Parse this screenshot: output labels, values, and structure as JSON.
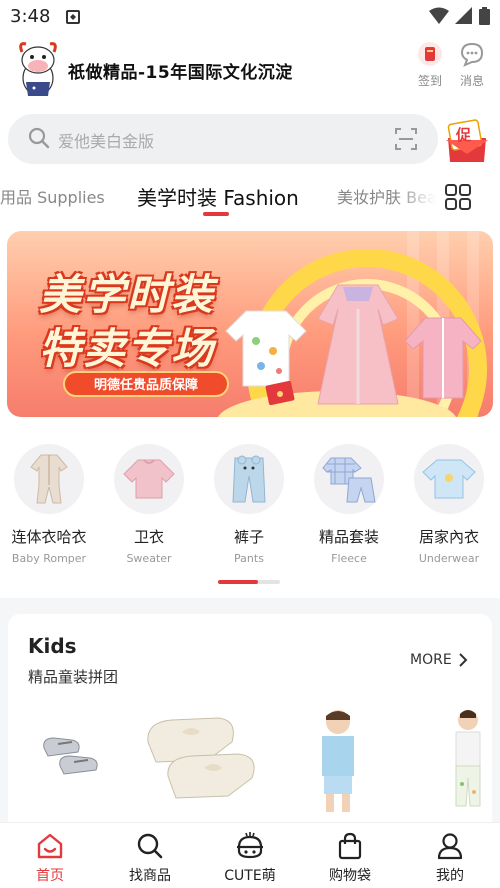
{
  "status_bar": {
    "time": "3:48"
  },
  "header": {
    "shop_title": "祇做精品-15年国际文化沉淀",
    "checkin_label": "签到",
    "message_label": "消息"
  },
  "search": {
    "placeholder": "爱他美白金版",
    "icon": "search-icon",
    "scan_icon": "scan-icon",
    "promo_badge": "促"
  },
  "tabs": {
    "items": [
      {
        "label": "用品 Supplies"
      },
      {
        "label": "美学时装 Fashion",
        "active": true
      },
      {
        "label": "美妆护肤 Bea"
      }
    ],
    "grid_icon": "grid-icon"
  },
  "banner": {
    "line1": "美学时装",
    "line2": "特卖专场",
    "tagline": "明德任贵品质保障"
  },
  "categories": [
    {
      "cn": "连体衣哈衣",
      "en": "Baby Romper"
    },
    {
      "cn": "卫衣",
      "en": "Sweater"
    },
    {
      "cn": "裤子",
      "en": "Pants"
    },
    {
      "cn": "精品套装",
      "en": "Fleece"
    },
    {
      "cn": "居家內衣",
      "en": "Underwear"
    }
  ],
  "kids": {
    "title": "Kids",
    "subtitle": "精品童装拼团",
    "more": "MORE"
  },
  "bottom_nav": [
    {
      "label": "首页",
      "icon": "home-icon",
      "active": true
    },
    {
      "label": "找商品",
      "icon": "search-icon"
    },
    {
      "label": "CUTE萌",
      "icon": "cute-icon"
    },
    {
      "label": "购物袋",
      "icon": "bag-icon"
    },
    {
      "label": "我的",
      "icon": "user-icon"
    }
  ],
  "colors": {
    "accent": "#e4393c",
    "search_bg": "#eef0f2",
    "section_bg": "#f5f6f8"
  }
}
